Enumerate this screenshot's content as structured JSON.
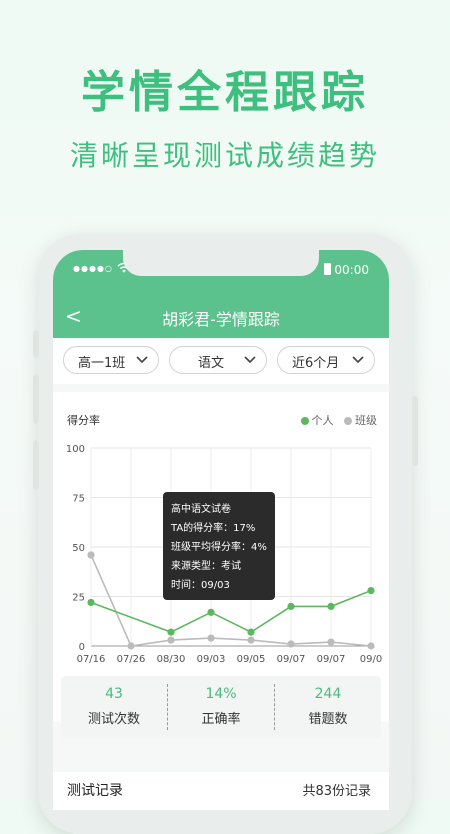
{
  "promo": {
    "headline": "学情全程跟踪",
    "subline": "清晰呈现测试成绩趋势"
  },
  "status_bar": {
    "signal": "●●●●○",
    "time": "00:00",
    "wifi_icon": "wifi-icon",
    "battery_icon": "battery-icon"
  },
  "nav": {
    "back": "<",
    "title": "胡彩君-学情跟踪"
  },
  "filters": {
    "class": "高一1班",
    "subject": "语文",
    "period": "近6个月"
  },
  "chart": {
    "y_label": "得分率",
    "legend_personal": "个人",
    "legend_class": "班级",
    "y_ticks": [
      "100",
      "75",
      "50",
      "25",
      "0"
    ],
    "colors": {
      "personal": "#5cb85c",
      "class": "#bbbbbb",
      "accent": "#4cbb80"
    }
  },
  "chart_data": {
    "type": "line",
    "categories": [
      "07/16",
      "07/26",
      "08/30",
      "09/03",
      "09/05",
      "09/07",
      "09/07",
      "09/0"
    ],
    "ylim": [
      0,
      100
    ],
    "ylabel": "得分率",
    "series": [
      {
        "name": "个人",
        "values": [
          22,
          null,
          7,
          17,
          7,
          20,
          20,
          28
        ]
      },
      {
        "name": "班级",
        "values": [
          46,
          0,
          3,
          4,
          3,
          1,
          2,
          0
        ]
      }
    ],
    "grid": true,
    "legend": "top-right"
  },
  "tooltip": {
    "line1": "高中语文试卷",
    "line2": "TA的得分率：17%",
    "line3": "班级平均得分率：4%",
    "line4": "来源类型：考试",
    "line5": "时间：09/03"
  },
  "stats": {
    "tests_value": "43",
    "tests_label": "测试次数",
    "accuracy_value": "14%",
    "accuracy_label": "正确率",
    "wrong_value": "244",
    "wrong_label": "错题数"
  },
  "records": {
    "title": "测试记录",
    "count": "共83份记录"
  }
}
